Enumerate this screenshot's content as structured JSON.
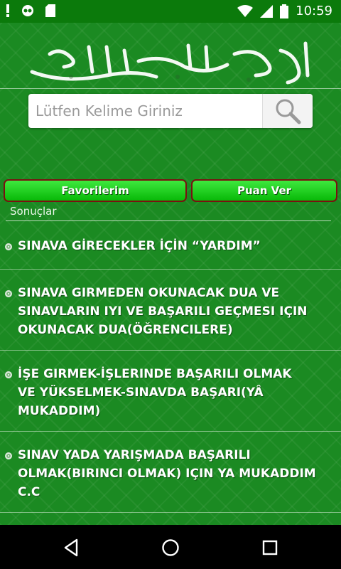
{
  "status_bar": {
    "time": "10:59",
    "icons": [
      "alert-icon",
      "voicemail-icon",
      "sd-card-icon",
      "wifi-icon",
      "signal-icon",
      "battery-icon"
    ]
  },
  "header": {
    "calligraphy_name": "bismillah-calligraphy"
  },
  "search": {
    "placeholder": "Lütfen Kelime Giriniz",
    "value": ""
  },
  "buttons": {
    "favorites_label": "Favorilerim",
    "rate_label": "Puan Ver"
  },
  "results": {
    "label": "Sonuçlar",
    "items": [
      {
        "line1": "SINAVA GİRECEKLER İÇİN “YARDIM”"
      },
      {
        "line1": "SINAVA GIRMEDEN OKUNACAK DUA VE",
        "line2": "SINAVLARIN IYI VE BAŞARILI GEÇMESI IÇIN",
        "line3": "OKUNACAK DUA(ÖĞRENCILERE)"
      },
      {
        "line1": "İŞE GIRMEK-İŞLERINDE BAŞARILI OLMAK",
        "line2": "VE YÜKSELMEK-SINAVDA BAŞARI(YÂ",
        "line3": "MUKADDIM)"
      },
      {
        "line1": "SINAV YADA YARIŞMADA BAŞARILI",
        "line2": "OLMAK(BIRINCI OLMAK) IÇIN  YA MUKADDIM",
        "line3": "C.C"
      }
    ]
  },
  "colors": {
    "status_bar": "#0b7a0b",
    "background": "#1b8a22",
    "button_green": "#22d022",
    "button_border": "#7a1010"
  },
  "nav": {
    "icons": [
      "back-icon",
      "home-icon",
      "recents-icon"
    ]
  }
}
